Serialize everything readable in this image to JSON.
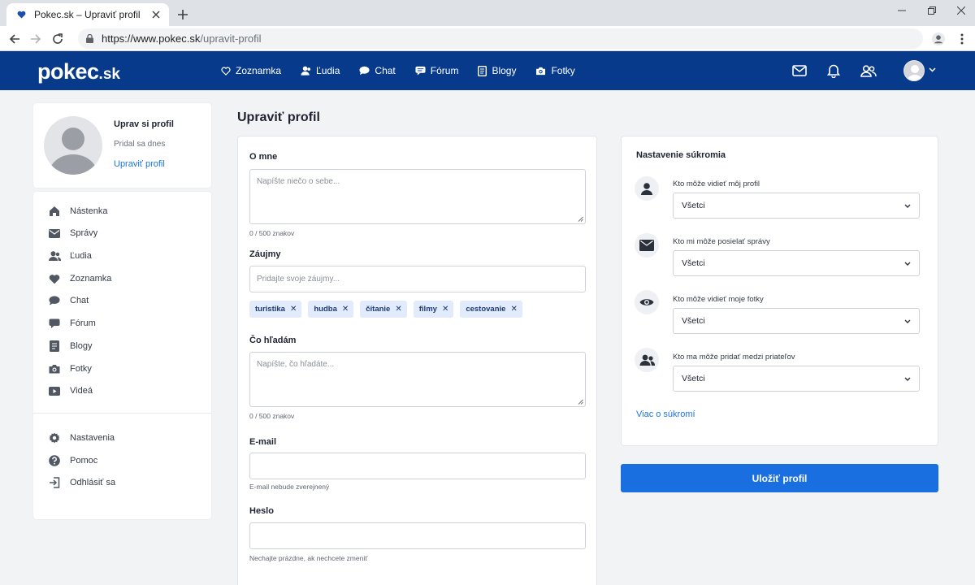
{
  "browser": {
    "tab_title": "Pokec.sk – Upraviť profil",
    "url_host": "https://www.pokec.sk",
    "url_path": "/upravit-profil"
  },
  "site": {
    "logo_main": "pokec",
    "logo_tld": ".sk",
    "brand_color": "#073a8a",
    "nav": [
      {
        "label": "Zoznamka",
        "icon": "heart-icon"
      },
      {
        "label": "Ľudia",
        "icon": "person-icon"
      },
      {
        "label": "Chat",
        "icon": "chat-bubble-icon"
      },
      {
        "label": "Fórum",
        "icon": "forum-icon"
      },
      {
        "label": "Blogy",
        "icon": "document-icon"
      },
      {
        "label": "Fotky",
        "icon": "camera-icon"
      }
    ]
  },
  "profile_card": {
    "title": "Uprav si profil",
    "subtitle": "Pridal sa dnes",
    "link": "Upraviť profil"
  },
  "sidebar": {
    "items": [
      {
        "label": "Nástenka",
        "icon": "home-icon"
      },
      {
        "label": "Správy",
        "icon": "envelope-icon"
      },
      {
        "label": "Ľudia",
        "icon": "people-icon"
      },
      {
        "label": "Zoznamka",
        "icon": "heart-icon"
      },
      {
        "label": "Chat",
        "icon": "chat-icon"
      },
      {
        "label": "Fórum",
        "icon": "forum-icon"
      },
      {
        "label": "Blogy",
        "icon": "blog-icon"
      },
      {
        "label": "Fotky",
        "icon": "camera-icon"
      },
      {
        "label": "Videá",
        "icon": "video-icon"
      }
    ],
    "bottom_items": [
      {
        "label": "Nastavenia",
        "icon": "gear-icon"
      },
      {
        "label": "Pomoc",
        "icon": "help-icon"
      },
      {
        "label": "Odhlásiť sa",
        "icon": "logout-icon"
      }
    ]
  },
  "form": {
    "page_title": "Upraviť profil",
    "about_label": "O mne",
    "about_placeholder": "Napíšte niečo o sebe...",
    "about_counter": "0 / 500 znakov",
    "interests_label": "Záujmy",
    "interests_placeholder": "Pridajte svoje záujmy...",
    "tags": [
      "turistika",
      "hudba",
      "čítanie",
      "filmy",
      "cestovanie"
    ],
    "seeking_label": "Čo hľadám",
    "seeking_placeholder": "Napíšte, čo hľadáte...",
    "seeking_counter": "0 / 500 znakov",
    "email_label": "E-mail",
    "email_value": "",
    "email_hint": "E-mail nebude zverejnený",
    "password_label": "Heslo",
    "password_value": "",
    "password_hint": "Nechajte prázdne, ak nechcete zmeniť"
  },
  "privacy": {
    "title": "Nastavenie súkromia",
    "rows": [
      {
        "label": "Kto môže vidieť môj profil",
        "value": "Všetci",
        "icon": "person-icon"
      },
      {
        "label": "Kto mi môže posielať správy",
        "value": "Všetci",
        "icon": "envelope-icon"
      },
      {
        "label": "Kto môže vidieť moje fotky",
        "value": "Všetci",
        "icon": "eye-icon"
      },
      {
        "label": "Kto ma môže pridať medzi priateľov",
        "value": "Všetci",
        "icon": "people-icon"
      }
    ],
    "link": "Viac o súkromí"
  },
  "save_button": "Uložiť profil",
  "colors": {
    "accent": "#1a6fe0",
    "link": "#1a73e8",
    "tag_bg": "#e1ebfb"
  }
}
